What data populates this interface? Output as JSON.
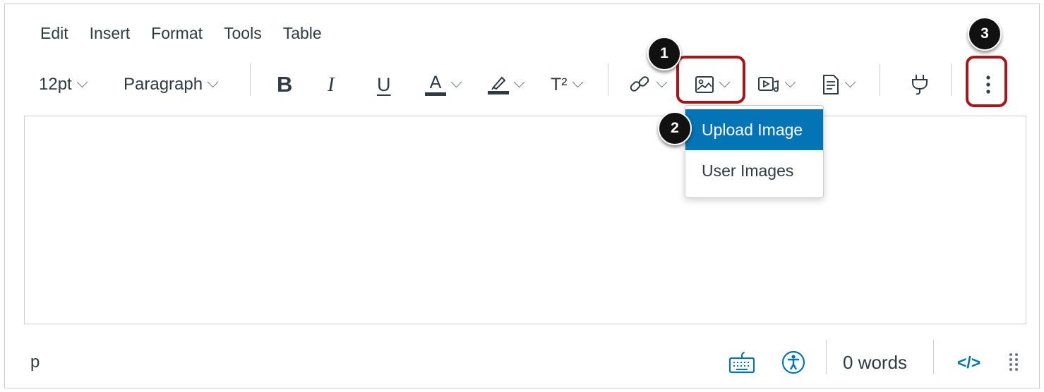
{
  "menubar": {
    "items": [
      "Edit",
      "Insert",
      "Format",
      "Tools",
      "Table"
    ]
  },
  "toolbar": {
    "font_size": "12pt",
    "block_format": "Paragraph",
    "bold_label": "B",
    "italic_label": "I",
    "underline_label": "U",
    "text_color_label": "A",
    "superscript_label": "T²"
  },
  "callouts": {
    "one": "1",
    "two": "2",
    "three": "3"
  },
  "image_menu": {
    "items": [
      "Upload Image",
      "User Images"
    ],
    "active_index": 0
  },
  "statusbar": {
    "element_path": "p",
    "word_count": "0 words",
    "html_toggle": "</>"
  },
  "colors": {
    "accent": "#0374b5",
    "callout_border": "#a4161a",
    "text": "#2d3b45"
  }
}
